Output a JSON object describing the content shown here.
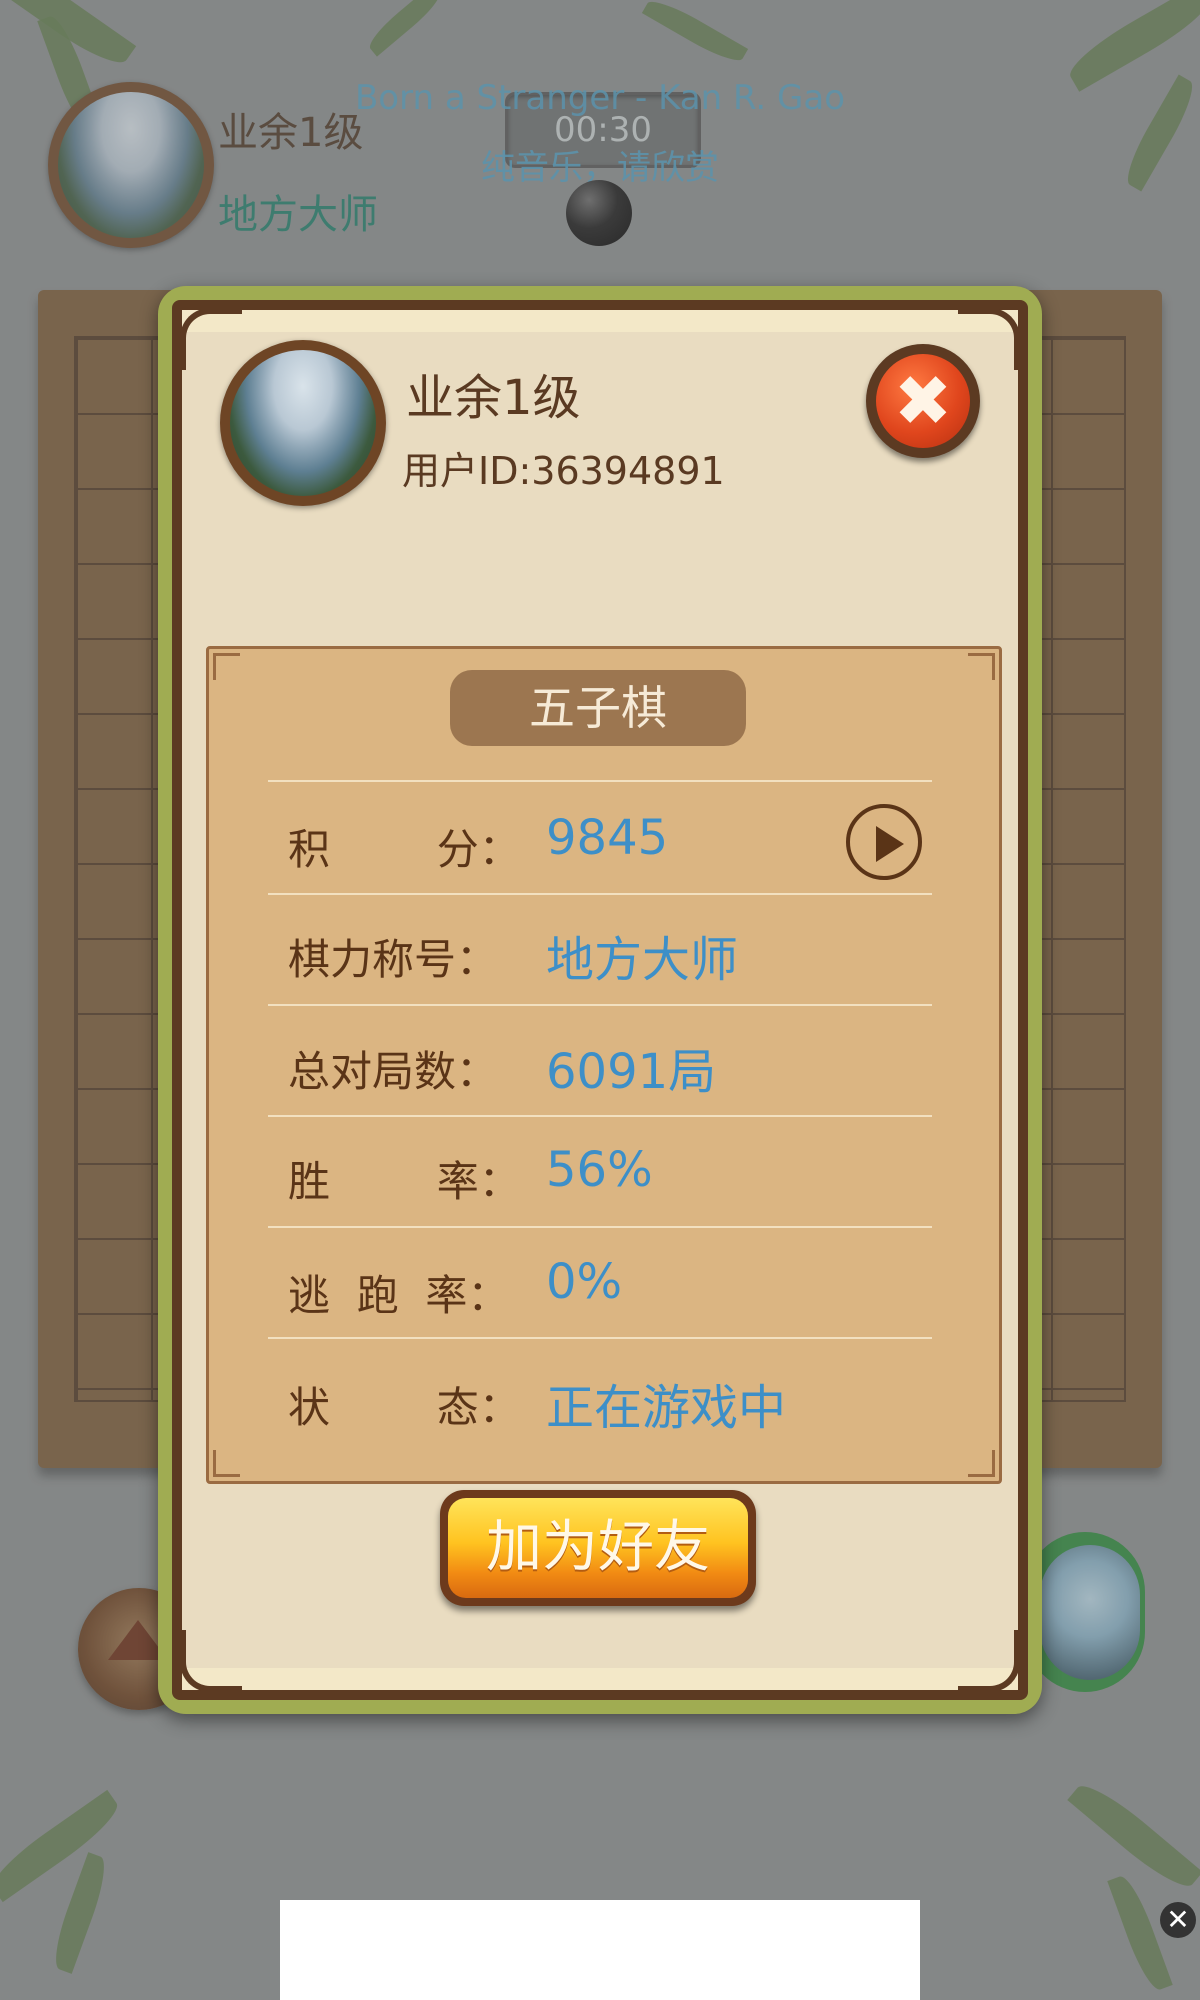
{
  "top_player": {
    "rank": "业余1级",
    "title": "地方大师"
  },
  "music": {
    "song": "Born a Stranger - Kan R. Gao",
    "subtitle": "纯音乐，请欣赏"
  },
  "timer": "00:30",
  "dialog": {
    "rank": "业余1级",
    "user_id": "用户ID:36394891",
    "game_name": "五子棋",
    "stats": [
      {
        "label": "积        分：",
        "value": "9845"
      },
      {
        "label": "棋力称号：",
        "value": "地方大师"
      },
      {
        "label": "总对局数：",
        "value": "6091局"
      },
      {
        "label": "胜        率：",
        "value": "56%"
      },
      {
        "label": "逃  跑  率：",
        "value": "0%"
      },
      {
        "label": "状        态：",
        "value": "正在游戏中"
      }
    ],
    "add_friend_label": "加为好友",
    "close_symbol": "✖"
  },
  "ad": {
    "close_symbol": "✕"
  },
  "colors": {
    "value_blue": "#3d8fc8",
    "label_brown": "#5a3417",
    "dialog_border_green": "#a0ac52",
    "panel_tan": "#dbb582"
  }
}
